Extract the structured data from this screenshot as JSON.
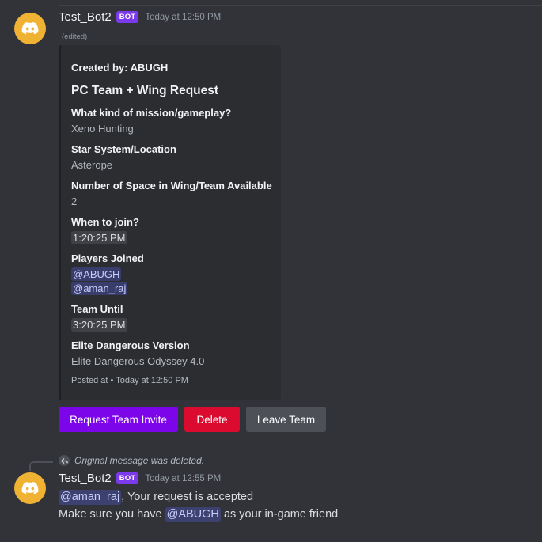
{
  "messages": [
    {
      "username": "Test_Bot2",
      "bot_tag": "BOT",
      "timestamp": "Today at 12:50 PM",
      "edited": "(edited)",
      "embed": {
        "author": "Created by: ABUGH",
        "title": "PC Team + Wing Request",
        "fields": [
          {
            "name": "What kind of mission/gameplay?",
            "value": "Xeno Hunting"
          },
          {
            "name": "Star System/Location",
            "value": "Asterope"
          },
          {
            "name": "Number of Space in Wing/Team Available",
            "value": "2"
          },
          {
            "name": "When to join?",
            "value": "1:20:25 PM"
          },
          {
            "name": "Players Joined",
            "values": [
              "@ABUGH",
              "@aman_raj"
            ]
          },
          {
            "name": "Team Until",
            "value": "3:20:25 PM"
          },
          {
            "name": "Elite Dangerous Version",
            "value": "Elite Dangerous Odyssey 4.0"
          }
        ],
        "footer": "Posted at • Today at 12:50 PM"
      },
      "buttons": {
        "request_invite": "Request Team Invite",
        "delete": "Delete",
        "leave_team": "Leave Team"
      },
      "colors": {
        "request_invite": "#7c05ea",
        "delete": "#da0b2e",
        "leave_team": "#4e5058"
      }
    },
    {
      "reply_text": "Original message was deleted.",
      "username": "Test_Bot2",
      "bot_tag": "BOT",
      "timestamp": "Today at 12:55 PM",
      "line1_mention": "@aman_raj",
      "line1_text": ", Your request is accepted",
      "line2_prefix": "Make sure you have",
      "line2_mention": "@ABUGH",
      "line2_suffix": "as your in-game friend"
    }
  ],
  "icons": {
    "avatar": "discord-logo-icon",
    "reply": "reply-arrow-icon"
  },
  "colors": {
    "background": "#313338",
    "avatar": "#f0b232",
    "bot_tag": "#7c3aed",
    "embed_bg": "#2b2d31",
    "mention_text": "#c9cdfb"
  }
}
